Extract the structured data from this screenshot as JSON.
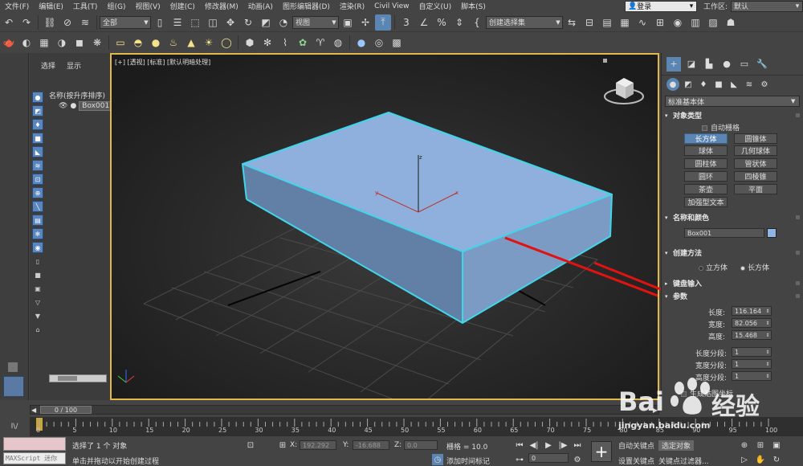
{
  "menubar": {
    "items": [
      "文件(F)",
      "编辑(E)",
      "工具(T)",
      "组(G)",
      "视图(V)",
      "创建(C)",
      "修改器(M)",
      "动画(A)",
      "图形编辑器(D)",
      "渲染(R)",
      "Civil View",
      "自定义(U)",
      "脚本(S)"
    ],
    "login": "登录",
    "workspace_label": "工作区:",
    "workspace_value": "默认"
  },
  "toolbar": {
    "selection_filter": "全部",
    "ref_coord": "视图",
    "named_selection": "创建选择集"
  },
  "explorer": {
    "tab_select": "选择",
    "tab_display": "显示",
    "header": "名称(按升序排序)",
    "object": "Box001"
  },
  "viewport": {
    "label": "[+] [透视] [标准] [默认明暗处理]",
    "object_color": "#8fb0dc",
    "selection_color": "#3fd6ea"
  },
  "command_panel": {
    "category": "标准基本体",
    "object_type": {
      "title": "对象类型",
      "autogrid": "自动栅格",
      "buttons": [
        "长方体",
        "圆锥体",
        "球体",
        "几何球体",
        "圆柱体",
        "管状体",
        "圆环",
        "四棱锥",
        "茶壶",
        "平面",
        "加强型文本"
      ],
      "active": "长方体"
    },
    "name_color": {
      "title": "名称和颜色",
      "name": "Box001",
      "color": "#8fb5e4"
    },
    "creation_method": {
      "title": "创建方法",
      "options": [
        "立方体",
        "长方体"
      ],
      "selected": "长方体"
    },
    "keyboard_entry": {
      "title": "键盘输入"
    },
    "parameters": {
      "title": "参数",
      "length_label": "长度:",
      "length": "116.164",
      "width_label": "宽度:",
      "width": "82.056",
      "height_label": "高度:",
      "height": "15.468",
      "length_segs_label": "长度分段:",
      "length_segs": "1",
      "width_segs_label": "宽度分段:",
      "width_segs": "1",
      "height_segs_label": "高度分段:",
      "height_segs": "1",
      "gen_mapping": "生成贴图坐标"
    }
  },
  "timeline": {
    "position": "0 / 100",
    "ticks": [
      "0",
      "5",
      "10",
      "15",
      "20",
      "25",
      "30",
      "35",
      "40",
      "45",
      "50",
      "55",
      "60",
      "65",
      "70",
      "75",
      "80",
      "85",
      "90",
      "95",
      "100"
    ]
  },
  "status": {
    "maxscript": "MAXScript 迷你",
    "selected": "选择了 1 个 对象",
    "prompt": "单击并拖动以开始创建过程",
    "x_label": "X:",
    "x": "192.292",
    "y_label": "Y:",
    "y": "-16.688",
    "z_label": "Z:",
    "z": "0.0",
    "grid": "栅格 = 10.0",
    "add_time_tag": "添加时间标记",
    "auto_key": "自动关键点",
    "selected_obj": "选定对象",
    "set_key": "设置关键点",
    "key_filters": "关键点过滤器...",
    "frame": "0"
  },
  "watermark": {
    "brand": "Bai",
    "brand2": "经验",
    "url": "jingyan.baidu.com"
  }
}
